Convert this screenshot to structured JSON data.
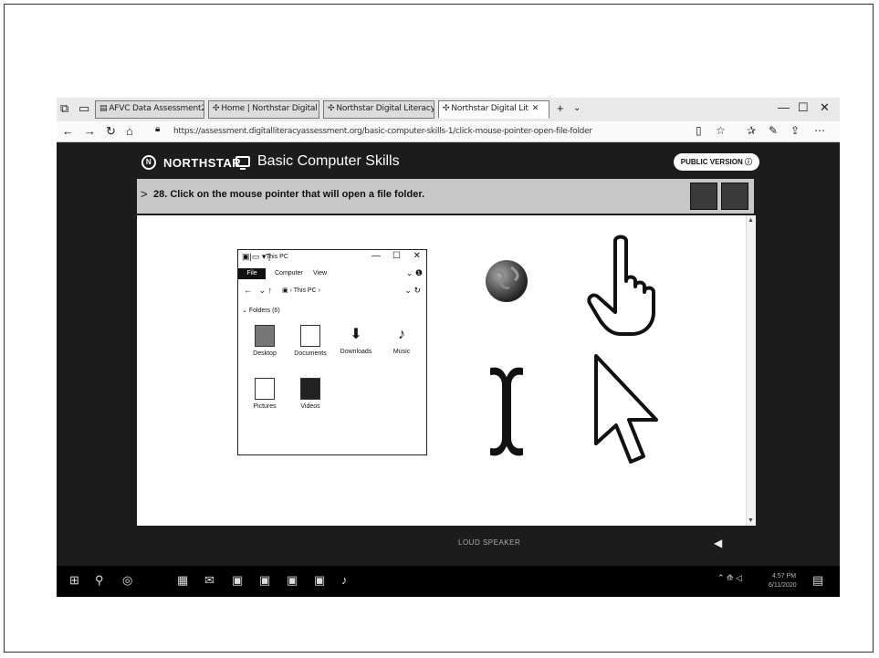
{
  "browser": {
    "tabs": [
      {
        "label": "AFVC Data Assessment2.pdf",
        "active": false
      },
      {
        "label": "Home | Northstar Digital Lit",
        "active": false
      },
      {
        "label": "Northstar Digital Literacy",
        "active": false
      },
      {
        "label": "Northstar Digital Lit",
        "active": true
      }
    ],
    "new_tab": "+",
    "url": "https://assessment.digitalliteracyassessment.org/basic-computer-skills-1/click-mouse-pointer-open-file-folder"
  },
  "app": {
    "brand": "NORTHSTAR",
    "module": "Basic Computer Skills",
    "public_version": "PUBLIC VERSION"
  },
  "question": {
    "text": "28. Click on the mouse pointer that will open a file folder."
  },
  "explorer": {
    "title": "This PC",
    "ribbon_file": "File",
    "ribbon_tabs": [
      "Computer",
      "View"
    ],
    "path": "This PC",
    "group": "Folders (6)",
    "items": [
      "Desktop",
      "Documents",
      "Downloads",
      "Music",
      "Pictures",
      "Videos"
    ]
  },
  "options": [
    {
      "name": "busy-globe",
      "icon": "globe-icon"
    },
    {
      "name": "hand-pointer",
      "icon": "hand-pointer-icon"
    },
    {
      "name": "text-select",
      "icon": "ibeam-cursor-icon"
    },
    {
      "name": "arrow-pointer",
      "icon": "arrow-cursor-icon"
    }
  ],
  "bottom_label": "LOUD SPEAKER",
  "taskbar": {
    "time": "4:57 PM",
    "date": "6/11/2020"
  }
}
